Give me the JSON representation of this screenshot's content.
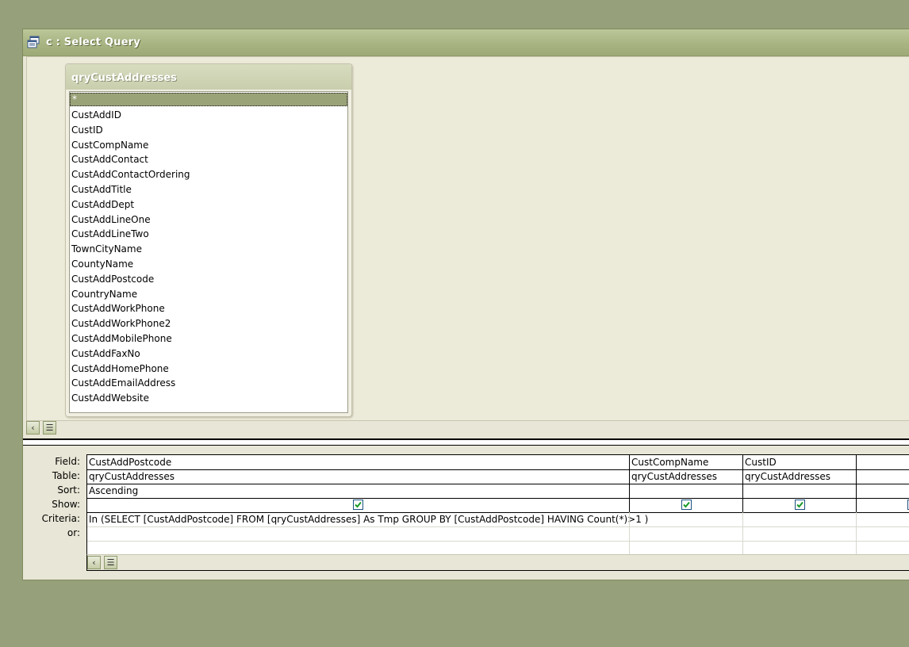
{
  "window": {
    "title": "c : Select Query"
  },
  "table": {
    "name": "qryCustAddresses",
    "fields": [
      "*",
      "CustAddID",
      "CustID",
      "CustCompName",
      "CustAddContact",
      "CustAddContactOrdering",
      "CustAddTitle",
      "CustAddDept",
      "CustAddLineOne",
      "CustAddLineTwo",
      "TownCityName",
      "CountyName",
      "CustAddPostcode",
      "CountryName",
      "CustAddWorkPhone",
      "CustAddWorkPhone2",
      "CustAddMobilePhone",
      "CustAddFaxNo",
      "CustAddHomePhone",
      "CustAddEmailAddress",
      "CustAddWebsite"
    ]
  },
  "grid": {
    "row_labels": [
      "Field:",
      "Table:",
      "Sort:",
      "Show:",
      "Criteria:",
      "or:"
    ],
    "columns": [
      {
        "field": "CustAddPostcode",
        "table": "qryCustAddresses",
        "sort": "Ascending",
        "show": true,
        "criteria": "In (SELECT [CustAddPostcode] FROM [qryCustAddresses] As Tmp GROUP BY [CustAddPostcode] HAVING Count(*)>1 )"
      },
      {
        "field": "CustCompName",
        "table": "qryCustAddresses",
        "sort": "",
        "show": true,
        "criteria": ""
      },
      {
        "field": "CustID",
        "table": "qryCustAddresses",
        "sort": "",
        "show": true,
        "criteria": ""
      },
      {
        "field": "",
        "table": "",
        "sort": "",
        "show": true,
        "criteria": ""
      }
    ]
  },
  "icons": {
    "title_icon": "query-icon",
    "scroll_left": "chevron-left-icon",
    "scroll_thumb": "scroll-thumb-icon",
    "check": "checkmark-icon"
  },
  "colors": {
    "desktop": "#96a07a",
    "titlebar": "#a8b482",
    "selection": "#9aa278",
    "check": "#1a9a2a"
  }
}
